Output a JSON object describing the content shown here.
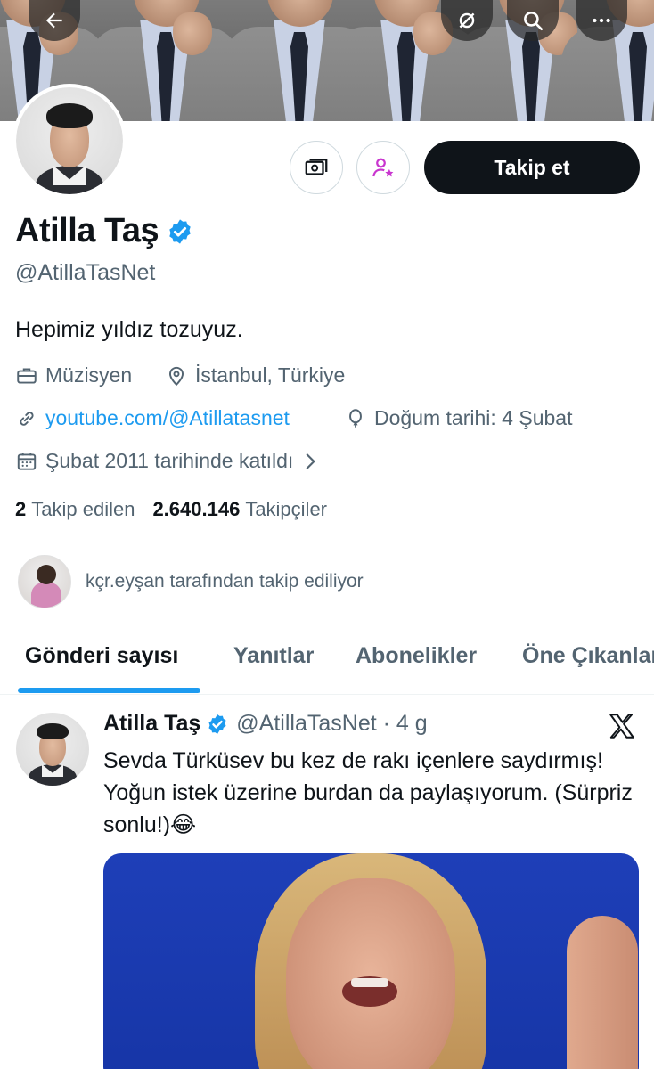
{
  "header": {
    "back_icon": "arrow-left-icon",
    "refresh_icon": "sync-icon",
    "search_icon": "search-icon",
    "more_icon": "more-icon"
  },
  "profile": {
    "name": "Atilla Taş",
    "handle": "@AtillaTasNet",
    "bio": "Hepimiz yıldız tozuyuz.",
    "profession": "Müzisyen",
    "location": "İstanbul, Türkiye",
    "website": "youtube.com/@Atillatasnet",
    "birthday": "Doğum tarihi: 4 Şubat",
    "joined": "Şubat 2011 tarihinde katıldı",
    "following_count": "2",
    "following_label": "Takip edilen",
    "followers_count": "2.640.146",
    "followers_label": "Takipçiler",
    "followed_by": "kçr.eyşan tarafından takip ediliyor",
    "follow_button": "Takip et",
    "accent_color": "#1d9bf0"
  },
  "tabs": [
    "Gönderi sayısı",
    "Yanıtlar",
    "Abonelikler",
    "Öne Çıkanlar"
  ],
  "tweet": {
    "name": "Atilla Taş",
    "handle": "@AtillaTasNet · 4 g",
    "text": "Sevda Türküsev bu kez de rakı içenlere saydırmış! Yoğun istek üzerine burdan da paylaşıyorum. (Sürpriz sonlu!)😂"
  }
}
